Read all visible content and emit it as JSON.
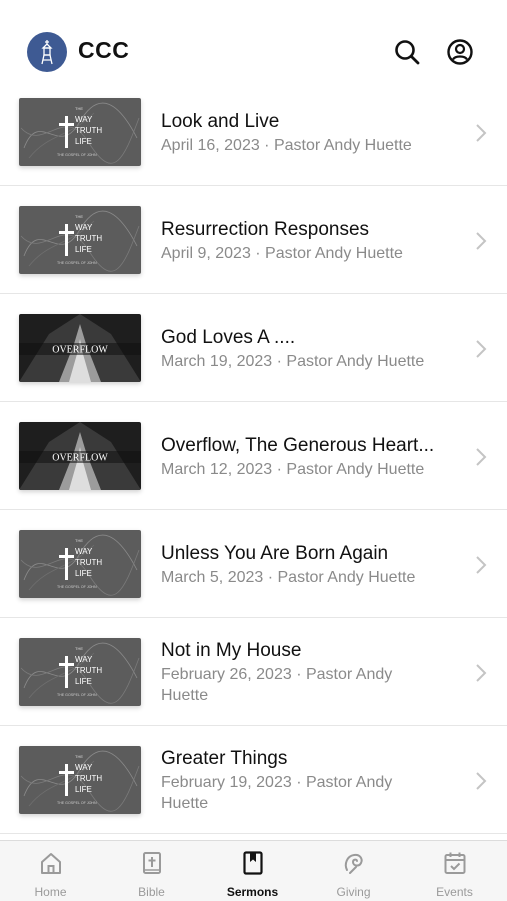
{
  "header": {
    "app_title": "CCC",
    "logo_icon": "church-tower-icon",
    "logo_color": "#3e5a93"
  },
  "sermons": [
    {
      "title": "Look and Live",
      "meta": "April 16, 2023 · Pastor Andy Huette",
      "series": "way-truth-life"
    },
    {
      "title": "Resurrection Responses",
      "meta": "April 9, 2023 · Pastor Andy Huette",
      "series": "way-truth-life"
    },
    {
      "title": "God Loves A ....",
      "meta": "March 19, 2023 · Pastor Andy Huette",
      "series": "overflow"
    },
    {
      "title": "Overflow, The Generous Heart...",
      "meta": "March 12, 2023 · Pastor Andy Huette",
      "series": "overflow"
    },
    {
      "title": "Unless You Are Born Again",
      "meta": "March 5, 2023 · Pastor Andy Huette",
      "series": "way-truth-life"
    },
    {
      "title": "Not in My House",
      "meta": "February 26, 2023 · Pastor Andy Huette",
      "series": "way-truth-life"
    },
    {
      "title": "Greater Things",
      "meta": "February 19, 2023 · Pastor Andy Huette",
      "series": "way-truth-life"
    }
  ],
  "thumbnails": {
    "wtl": {
      "line1": "THE",
      "way": "WAY",
      "truth": "TRUTH",
      "life": "LIFE",
      "sub": "THE GOSPEL OF JOHN"
    },
    "overflow": {
      "word": "OVERFLOW"
    }
  },
  "tabs": [
    {
      "label": "Home",
      "icon": "home-icon"
    },
    {
      "label": "Bible",
      "icon": "bible-icon"
    },
    {
      "label": "Sermons",
      "icon": "sermons-bookmark-icon",
      "active": true
    },
    {
      "label": "Giving",
      "icon": "giving-icon"
    },
    {
      "label": "Events",
      "icon": "events-calendar-icon"
    }
  ]
}
